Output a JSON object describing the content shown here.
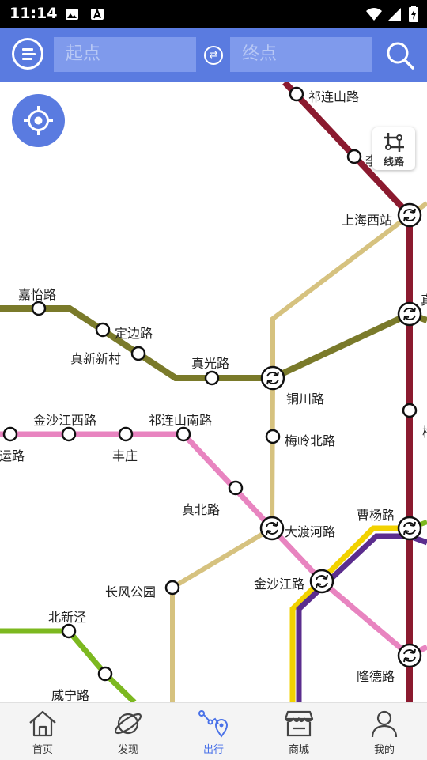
{
  "status_bar": {
    "time": "11:14"
  },
  "search": {
    "start_placeholder": "起点",
    "end_placeholder": "终点"
  },
  "map": {
    "route_button_label": "线路",
    "stations": {
      "qilianshan_lu": "祁连山路",
      "li": "李",
      "shanghai_west": "上海西站",
      "zhen_cut": "真",
      "jiayi_lu": "嘉怡路",
      "dingbian_lu": "定边路",
      "zhenxin_xincun": "真新新村",
      "zhenguang_lu": "真光路",
      "tongchuan_lu": "铜川路",
      "jinshajiang_west": "金沙江西路",
      "qilianshan_south": "祁连山南路",
      "meiling_north": "梅岭北路",
      "yun_lu_cut": "运路",
      "fengzhuang": "丰庄",
      "zhenbei_lu": "真北路",
      "dadu_he_lu": "大渡河路",
      "caoyang_lu": "曹杨路",
      "changfeng_park": "长风公园",
      "jinshajiang_lu": "金沙江路",
      "beixinjing": "北新泾",
      "longde_lu": "隆德路",
      "weining_lu": "威宁路",
      "mei_cut": "梅"
    }
  },
  "nav": [
    {
      "label": "首页"
    },
    {
      "label": "发现"
    },
    {
      "label": "出行"
    },
    {
      "label": "商城"
    },
    {
      "label": "我的"
    }
  ],
  "colors": {
    "topbar": "#5a7be0",
    "line_red": "#8b1a2f",
    "line_olive": "#7a7a2a",
    "line_tan": "#d6c27f",
    "line_pink": "#e884c0",
    "line_yellow": "#f2d200",
    "line_purple": "#5b2d8e",
    "line_green": "#7cb81f",
    "nav_active": "#4a72e8"
  }
}
